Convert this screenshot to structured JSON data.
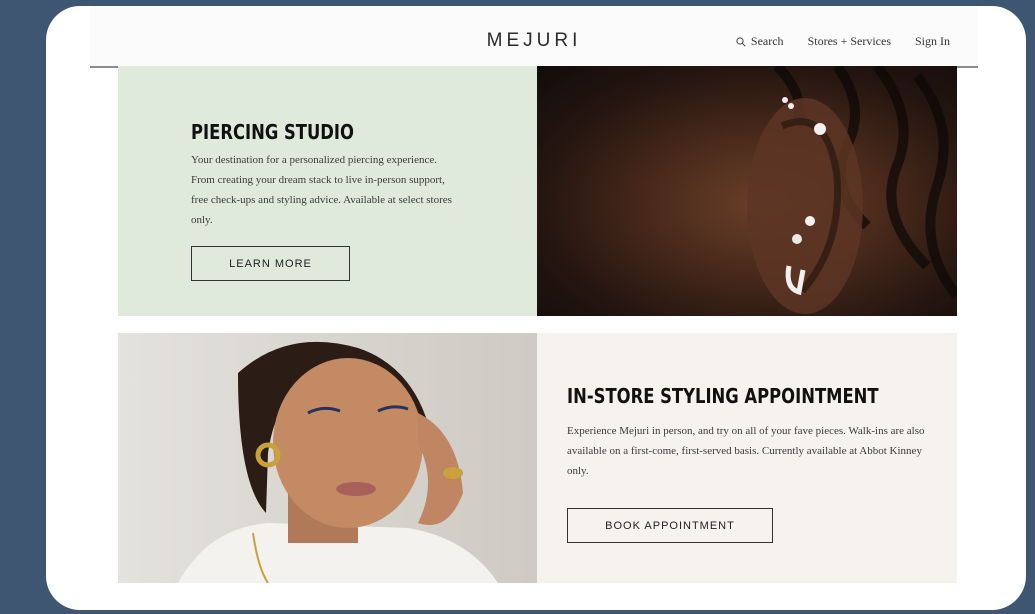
{
  "header": {
    "logo": "MEJURI",
    "search_label": "Search",
    "stores_services_label": "Stores + Services",
    "sign_in_label": "Sign In"
  },
  "piercing": {
    "title": "PIERCING STUDIO",
    "description": "Your destination for a personalized piercing experience. From creating your dream stack to live in-person support, free check-ups and styling advice. Available at select stores only.",
    "button_label": "LEARN MORE"
  },
  "styling": {
    "title": "IN-STORE STYLING APPOINTMENT",
    "description": "Experience Mejuri in person, and try on all of your fave pieces. Walk-ins are also available on a first-come, first-served basis. Currently available at Abbot Kinney only.",
    "button_label": "BOOK APPOINTMENT"
  },
  "colors": {
    "background": "#3e5672",
    "piercing_panel": "#dfeadd",
    "styling_panel": "#f6f3ef"
  },
  "icons": [
    "search-icon"
  ]
}
